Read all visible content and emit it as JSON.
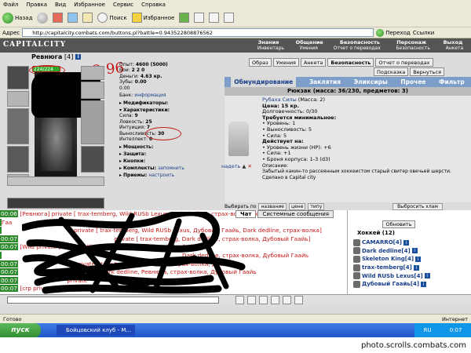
{
  "menubar": [
    "Файл",
    "Правка",
    "Вид",
    "Избранное",
    "Сервис",
    "Справка"
  ],
  "toolbar": {
    "back": "Назад",
    "search": "Поиск",
    "favorites": "Избранное"
  },
  "address": {
    "label": "Адрес",
    "url": "http://capitalcity.combats.com/buttons.pl?battle=0.943522808876562",
    "go": "Переход",
    "links": "Ссылки"
  },
  "game": {
    "logo": "CAPITALCITY",
    "nav_top": [
      "Знания",
      "Общение",
      "Безопасность",
      "Персонаж",
      "Выход"
    ],
    "nav_sub": [
      "Инвентарь",
      "Умения",
      "Отчет о переводах",
      "Безопасность",
      "Анкета"
    ],
    "char_name": "Ревнюга",
    "char_level": "[4]",
    "hp": "224/224",
    "scribble_number": "2 96",
    "stats": {
      "exp_label": "Опыт:",
      "exp_value": "4600 (5000)",
      "battles_label": "Бои:",
      "battles_value": "2 2 0",
      "money_label": "Деньги:",
      "money_value": "4.63 кр.",
      "zubs_label": "Зубы:",
      "zubs_value": "0.00",
      "ekr_value": "0.00"
    },
    "bank_label": "Банк:",
    "bank_link": "информация",
    "dropdowns1": [
      "Модификаторы:",
      "Характеристики:"
    ],
    "attrs": [
      {
        "label": "Сила:",
        "value": "9"
      },
      {
        "label": "Ловкость:",
        "value": "25"
      },
      {
        "label": "Интуиция:",
        "value": "7"
      },
      {
        "label": "Выносливость:",
        "value": "30"
      },
      {
        "label": "Интеллект:",
        "value": "0"
      }
    ],
    "dropdowns2": [
      "Мощность:",
      "Защита:",
      "Кнопки:",
      "Комплекты:",
      "Приемы:"
    ],
    "remember": "запомнить",
    "configure": "настроить",
    "right_tabs": [
      "Образ",
      "Умения",
      "Анкета",
      "Безопасность",
      "Отчет о переводах"
    ],
    "right_btns": [
      "Подсказка",
      "Вернуться"
    ],
    "inv_tabs": [
      "Обмундирование",
      "Заклятия",
      "Эликсиры",
      "Прочее",
      "Фильтр"
    ],
    "backpack": "Рюкзак (масса: 36/230, предметов: 3)",
    "item": {
      "name": "Рубаха Силы",
      "mass": "(Масса: 2)",
      "price": "Цена: 15 кр.",
      "durability": "Долговечность: 0/30",
      "req_title": "Требуется минимальное:",
      "reqs": [
        "• Уровень: 1",
        "• Выносливость: 5",
        "• Сила: 5"
      ],
      "acts_title": "Действует на:",
      "acts": [
        "• Уровень жизни (HP): +6",
        "• Сила: +1",
        "• Броня корпуса: 1-3 (d3)"
      ],
      "desc_title": "Описание:",
      "desc": "Забытый какин-то рассеянным хоккеистом старый свитер овечьей шерсти.",
      "made": "Сделано в Capital city",
      "wear": "надеть"
    },
    "sort": {
      "label": "Выбирать по",
      "opts": [
        "название",
        "цене",
        "типу"
      ],
      "take": "Выбросить хлам"
    },
    "chat_tabs": [
      "Чат",
      "Системные сообщения"
    ],
    "chat": [
      {
        "time": "00:06",
        "text": "[Ревнюга] private [ trax-temberg, Wild RUSb Lexus, Dark dedline, страх-волка, Skeleton King, Дубовый"
      },
      {
        "time": "",
        "text": "Гаа"
      },
      {
        "time": "",
        "text": "private [ trax-temberg, Wild RUSb Lexus, Дубовый Гаайь, Dark dedline, страх-волка]"
      },
      {
        "time": "00:07",
        "text": "private [ trax-temberg, Dark dedline, страх-волка, Дубовый Гаайь]"
      },
      {
        "time": "00:07",
        "text": "[Wild private [ Dark dedline, страх-волка, Дубовый Гаайь ]"
      },
      {
        "time": "",
        "text": "Dark dedline, страх-волка, Дубовый Гаайь"
      },
      {
        "time": "00:07",
        "text": "private [ trax-temberg, Ревнюга, страх-волка, Дубовый"
      },
      {
        "time": "00:07",
        "text": "private [ Dark dedline, Ревнюга, страх-волка, Дубовый Гаайь"
      },
      {
        "time": "00:07",
        "text": "private"
      },
      {
        "time": "00:07",
        "text": "[crp private [ Ревнюга ]"
      }
    ],
    "refresh": "Обновить",
    "room": "Хоккей (12)",
    "users": [
      "CAMARRO[4]",
      "Dark dedline[4]",
      "Skeleton King[4]",
      "trax-temberg[4]",
      "Wild RUSb Lexus[4]",
      "Дубовый Гаайь[4]"
    ]
  },
  "statusbar": {
    "left": "Готово",
    "right": "Интернет"
  },
  "taskbar": {
    "start": "пуск",
    "item": "Бойцовский клуб - М...",
    "lang": "RU",
    "clock": "0:07"
  },
  "caption": "photo.scrolls.combats.com"
}
